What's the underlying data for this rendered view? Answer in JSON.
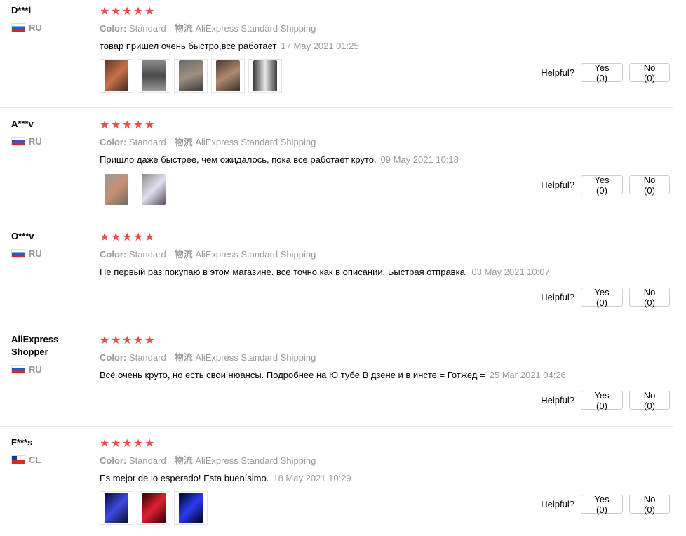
{
  "colors": {
    "star": "#ef4b4b",
    "muted": "#999999",
    "border": "#e8e8e8"
  },
  "reviews": [
    {
      "user": "D***i",
      "country": "RU",
      "flag": "ru-flag-icon",
      "rating": 5,
      "color_label": "Color:",
      "color_value": "Standard",
      "ship_label": "物流",
      "ship_value": "AliExpress Standard Shipping",
      "text": "товар пришел очень быстро,все работает",
      "date": "17 May 2021 01:25",
      "photo_count": 5,
      "helpful": "Helpful?",
      "yes": "Yes (0)",
      "no": "No (0)"
    },
    {
      "user": "A***v",
      "country": "RU",
      "flag": "ru-flag-icon",
      "rating": 5,
      "color_label": "Color:",
      "color_value": "Standard",
      "ship_label": "物流",
      "ship_value": "AliExpress Standard Shipping",
      "text": "Пришло даже быстрее, чем ожидалось, пока все работает круто.",
      "date": "09 May 2021 10:18",
      "photo_count": 2,
      "helpful": "Helpful?",
      "yes": "Yes (0)",
      "no": "No (0)"
    },
    {
      "user": "O***v",
      "country": "RU",
      "flag": "ru-flag-icon",
      "rating": 5,
      "color_label": "Color:",
      "color_value": "Standard",
      "ship_label": "物流",
      "ship_value": "AliExpress Standard Shipping",
      "text": "Не первый раз покупаю в этом магазине. все точно как в описании. Быстрая отправка.",
      "date": "03 May 2021 10:07",
      "photo_count": 0,
      "helpful": "Helpful?",
      "yes": "Yes (0)",
      "no": "No (0)"
    },
    {
      "user": "AliExpress Shopper",
      "country": "RU",
      "flag": "ru-flag-icon",
      "rating": 5,
      "color_label": "Color:",
      "color_value": "Standard",
      "ship_label": "物流",
      "ship_value": "AliExpress Standard Shipping",
      "text": "Всё очень круто, но есть свои нюансы. Подробнее на Ю тубе В дзене и в инсте = Готжед =",
      "date": "25 Mar 2021 04:26",
      "photo_count": 0,
      "helpful": "Helpful?",
      "yes": "Yes (0)",
      "no": "No (0)"
    },
    {
      "user": "F***s",
      "country": "CL",
      "flag": "cl-flag-icon",
      "rating": 5,
      "color_label": "Color:",
      "color_value": "Standard",
      "ship_label": "物流",
      "ship_value": "AliExpress Standard Shipping",
      "text": "Es mejor de lo esperado! Esta buenísimo.",
      "date": "18 May 2021 10:29",
      "photo_count": 3,
      "helpful": "Helpful?",
      "yes": "Yes (0)",
      "no": "No (0)"
    }
  ]
}
